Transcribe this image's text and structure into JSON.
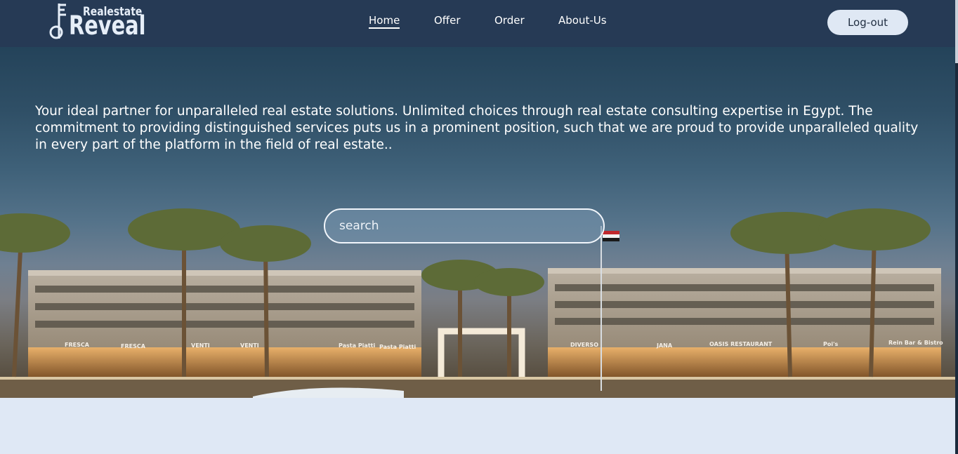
{
  "brand": {
    "small": "Realestate",
    "big": "Reveal"
  },
  "nav": {
    "items": [
      {
        "label": "Home",
        "active": true
      },
      {
        "label": "Offer",
        "active": false
      },
      {
        "label": "Order",
        "active": false
      },
      {
        "label": "About-Us",
        "active": false
      }
    ]
  },
  "auth": {
    "logout_label": "Log-out"
  },
  "hero": {
    "tagline": "Your ideal partner for unparalleled real estate solutions. Unlimited choices through real estate consulting expertise in Egypt. The commitment to providing distinguished services puts us in a prominent position, such that we are proud to provide unparalleled quality in every part of the platform in the field of real estate..",
    "search_placeholder": "search",
    "storefronts": [
      "FRESCA",
      "FRESCA",
      "VENTI",
      "VENTI",
      "Pasta Piatti",
      "Pasta Piatti",
      "DIVERSO",
      "JANA",
      "OASIS RESTAURANT",
      "Poi's",
      "Rein Bar & Bistro"
    ]
  },
  "colors": {
    "header_bg": "#263a55",
    "button_bg": "#dfe8f4",
    "page_bg": "#dfe8f5"
  }
}
